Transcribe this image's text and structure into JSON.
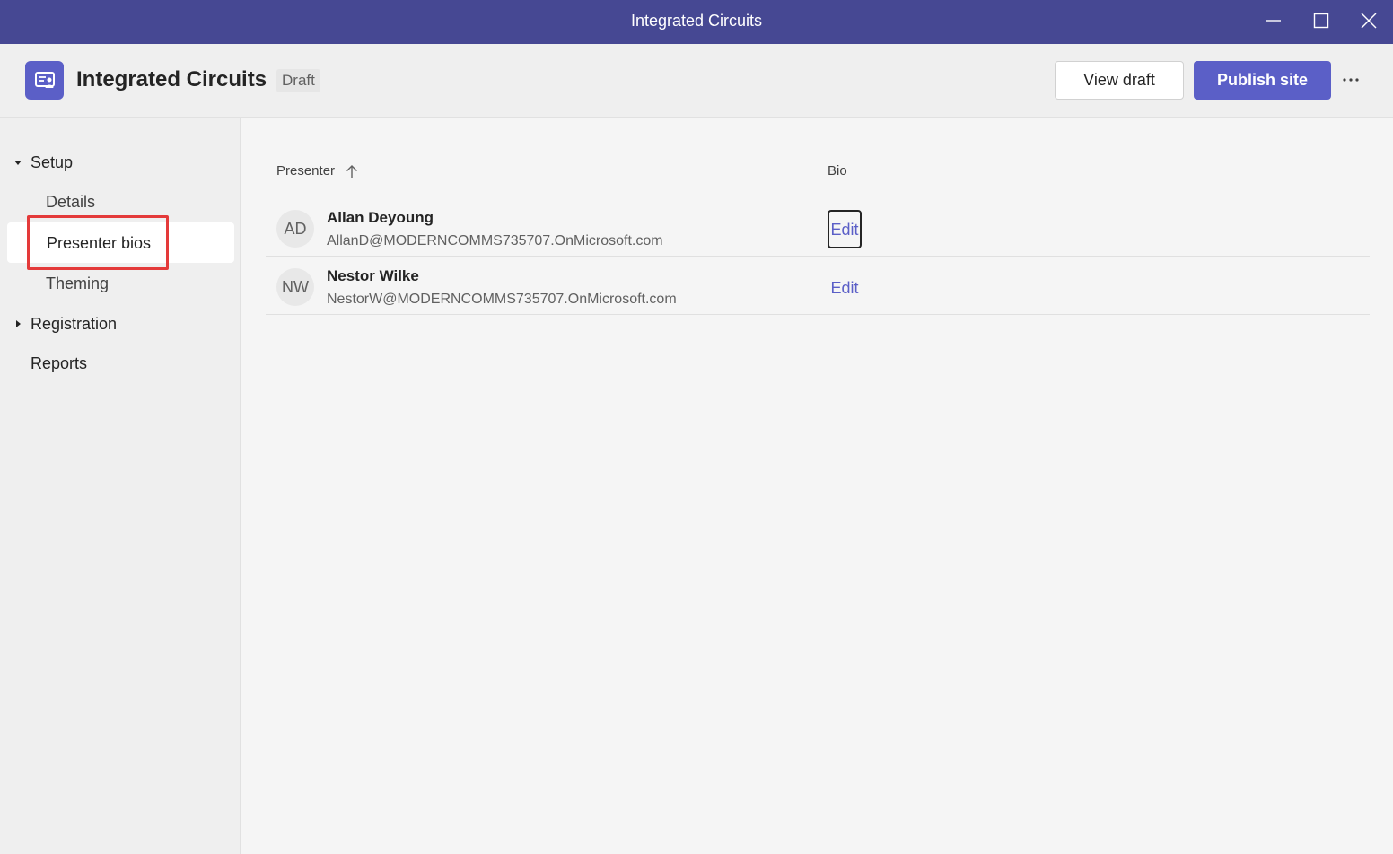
{
  "window": {
    "title": "Integrated Circuits",
    "controls": [
      "minimize-icon",
      "maximize-icon",
      "close-icon"
    ]
  },
  "header": {
    "app_icon": "presentation-icon",
    "title": "Integrated Circuits",
    "status_badge": "Draft",
    "view_draft_label": "View draft",
    "publish_label": "Publish site",
    "more_icon": "more-horizontal-icon"
  },
  "sidebar": {
    "setup_label": "Setup",
    "setup_expanded": true,
    "items": {
      "details": "Details",
      "presenter_bios": "Presenter bios",
      "theming": "Theming"
    },
    "selected": "presenter_bios",
    "registration_label": "Registration",
    "registration_expanded": false,
    "reports_label": "Reports"
  },
  "table": {
    "columns": {
      "presenter": "Presenter",
      "presenter_sort": "ascending",
      "bio": "Bio"
    },
    "rows": [
      {
        "initials": "AD",
        "name": "Allan Deyoung",
        "email": "AllanD@MODERNCOMMS735707.OnMicrosoft.com",
        "action": "Edit"
      },
      {
        "initials": "NW",
        "name": "Nestor Wilke",
        "email": "NestorW@MODERNCOMMS735707.OnMicrosoft.com",
        "action": "Edit"
      }
    ]
  },
  "colors": {
    "titlebar": "#464893",
    "accent": "#5b5fc7",
    "highlight": "#e43a3a"
  }
}
